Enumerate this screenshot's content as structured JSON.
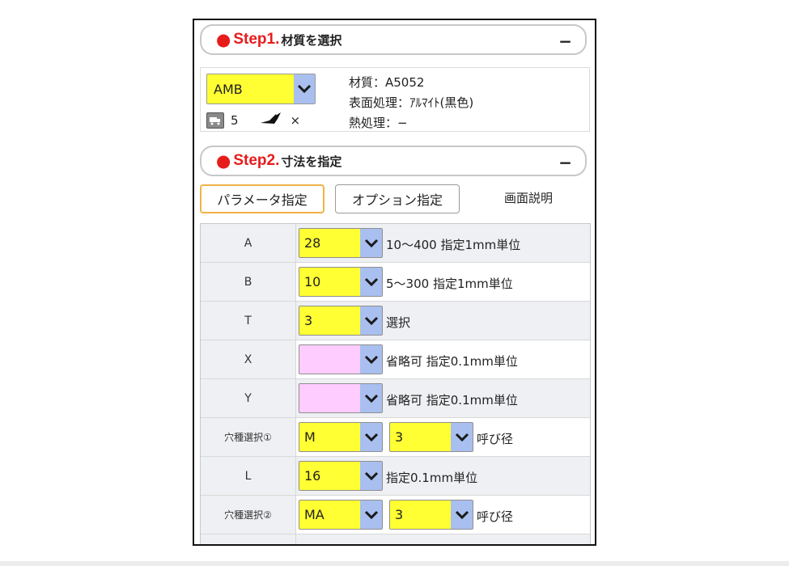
{
  "step1": {
    "step_no": "Step1.",
    "title": "材質を選択",
    "collapse": "−"
  },
  "material": {
    "select_value": "AMB",
    "ship_days": "5",
    "bird_mark": "×",
    "spec": [
      "材質：A5052",
      "表面処理：ｱﾙﾏｲﾄ(黒色)",
      "熱処理：−"
    ]
  },
  "step2": {
    "step_no": "Step2.",
    "title": "寸法を指定",
    "collapse": "−"
  },
  "modes": {
    "param": "パラメータ指定",
    "option": "オプション指定",
    "help": "画面説明"
  },
  "params": [
    {
      "label": "A",
      "value": "28",
      "note": "10～400 指定1mm単位"
    },
    {
      "label": "B",
      "value": "10",
      "note": "5～300 指定1mm単位"
    },
    {
      "label": "T",
      "value": "3",
      "note": "選択"
    },
    {
      "label": "X",
      "value": "",
      "note": "省略可 指定0.1mm単位"
    },
    {
      "label": "Y",
      "value": "",
      "note": "省略可 指定0.1mm単位"
    },
    {
      "label": "穴種選択①",
      "value": "M",
      "value2": "3",
      "note": "呼び径"
    },
    {
      "label": "L",
      "value": "16",
      "note": "指定0.1mm単位"
    },
    {
      "label": "穴種選択②",
      "value": "MA",
      "value2": "3",
      "note": "呼び径"
    }
  ],
  "colors": {
    "accent_red": "#e81b1b",
    "select_yellow": "#ffff33",
    "select_pink": "#ffccff",
    "arrow_blue": "#a9bff0",
    "active_orange": "#f0b347"
  },
  "icons": [
    "truck-icon",
    "bird-icon",
    "chevron-down-icon"
  ]
}
